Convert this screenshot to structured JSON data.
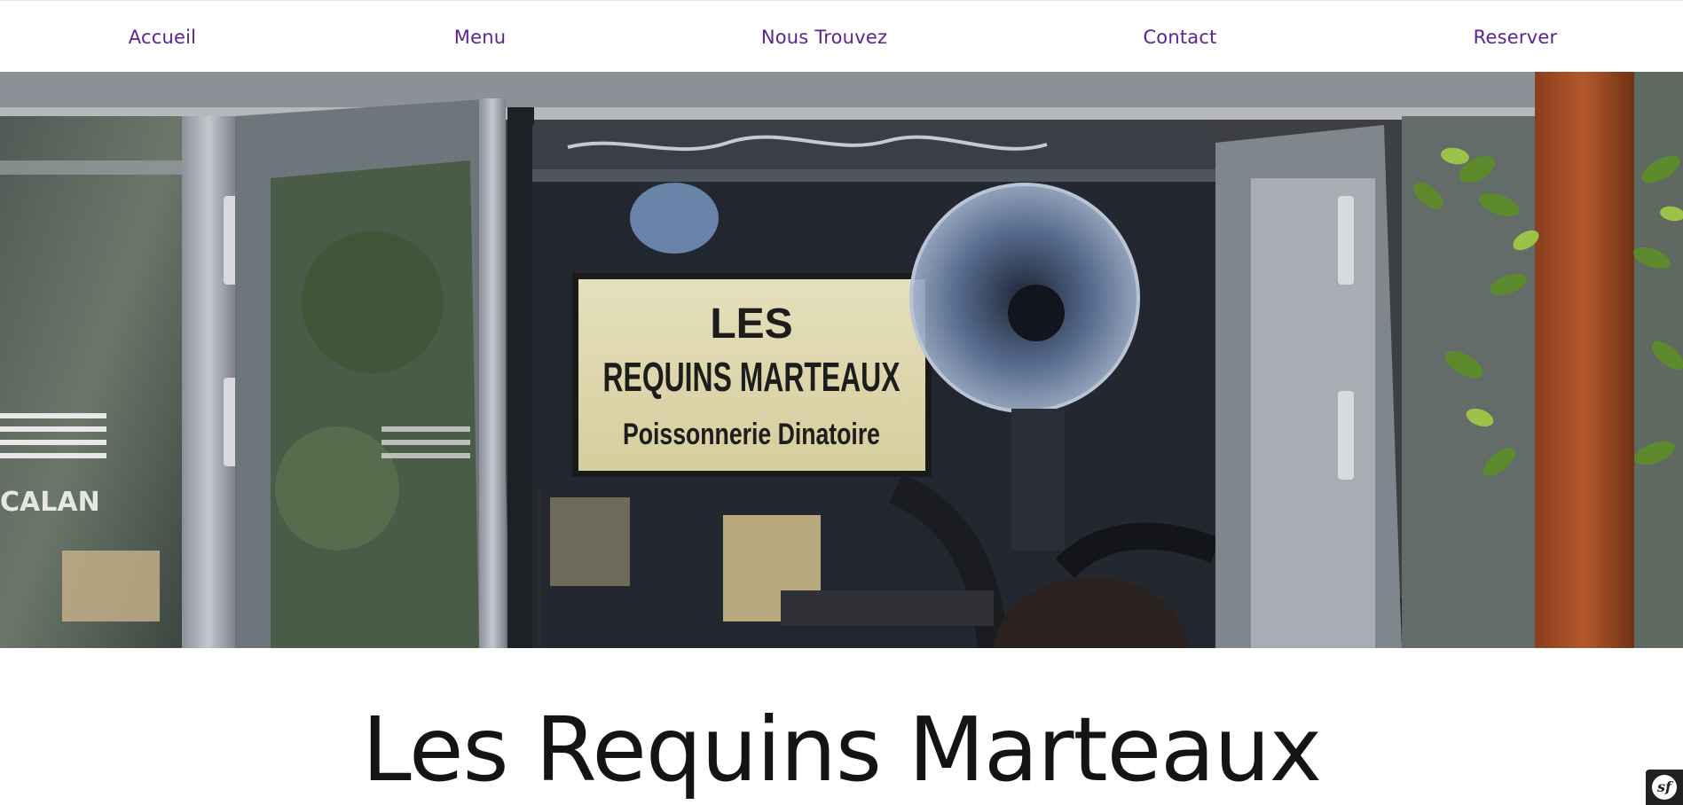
{
  "nav": {
    "items": [
      {
        "label": "Accueil"
      },
      {
        "label": "Menu"
      },
      {
        "label": "Nous Trouvez"
      },
      {
        "label": "Contact"
      },
      {
        "label": "Reserver"
      }
    ],
    "link_color": "#5b2494"
  },
  "hero": {
    "sign": {
      "line1": "LES",
      "line2": "REQUINS MARTEAUX",
      "line3": "Poissonnerie Dinatoire"
    },
    "window_text": "CALAN"
  },
  "main": {
    "title": "Les Requins Marteaux"
  },
  "toolbar": {
    "logo_text": "sf"
  }
}
